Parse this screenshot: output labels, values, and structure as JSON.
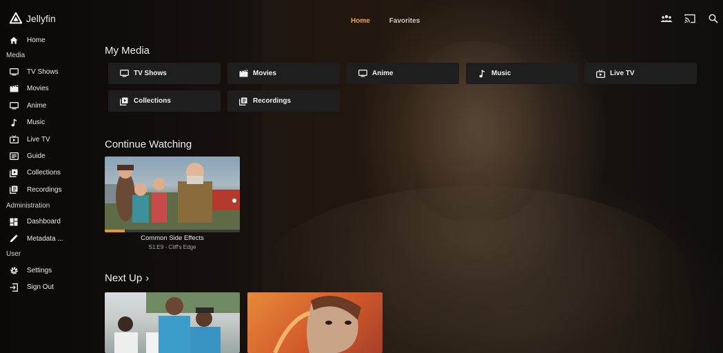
{
  "app": {
    "name": "Jellyfin"
  },
  "header": {
    "tabs": [
      {
        "label": "Home",
        "active": true
      },
      {
        "label": "Favorites",
        "active": false
      }
    ],
    "icons": [
      "users-icon",
      "cast-icon",
      "search-icon"
    ]
  },
  "sidebar": {
    "home": {
      "label": "Home",
      "icon": "home-icon"
    },
    "media_section": "Media",
    "media_items": [
      {
        "label": "TV Shows",
        "icon": "tv-icon"
      },
      {
        "label": "Movies",
        "icon": "movie-icon"
      },
      {
        "label": "Anime",
        "icon": "tv-icon"
      },
      {
        "label": "Music",
        "icon": "music-icon"
      },
      {
        "label": "Live TV",
        "icon": "live-tv-icon"
      },
      {
        "label": "Guide",
        "icon": "guide-icon"
      },
      {
        "label": "Collections",
        "icon": "collections-icon"
      },
      {
        "label": "Recordings",
        "icon": "recordings-icon"
      }
    ],
    "admin_section": "Administration",
    "admin_items": [
      {
        "label": "Dashboard",
        "icon": "dashboard-icon"
      },
      {
        "label": "Metadata ...",
        "icon": "edit-icon"
      }
    ],
    "user_section": "User",
    "user_items": [
      {
        "label": "Settings",
        "icon": "gear-icon"
      },
      {
        "label": "Sign Out",
        "icon": "sign-out-icon"
      }
    ]
  },
  "main": {
    "my_media": {
      "title": "My Media",
      "libraries": [
        {
          "label": "TV Shows",
          "icon": "tv-icon"
        },
        {
          "label": "Movies",
          "icon": "movie-icon"
        },
        {
          "label": "Anime",
          "icon": "tv-icon"
        },
        {
          "label": "Music",
          "icon": "music-icon"
        },
        {
          "label": "Live TV",
          "icon": "live-tv-icon"
        },
        {
          "label": "Collections",
          "icon": "collections-icon"
        },
        {
          "label": "Recordings",
          "icon": "recordings-icon"
        }
      ]
    },
    "continue_watching": {
      "title": "Continue Watching",
      "items": [
        {
          "title": "Common Side Effects",
          "subtitle": "S1:E9 - Cliff's Edge",
          "progress": 0.15
        }
      ]
    },
    "next_up": {
      "title": "Next Up",
      "chevron": "›"
    }
  },
  "colors": {
    "accent": "#f2a43a",
    "progress": "#e39b2c",
    "button_bg": "#1f1e1e"
  }
}
